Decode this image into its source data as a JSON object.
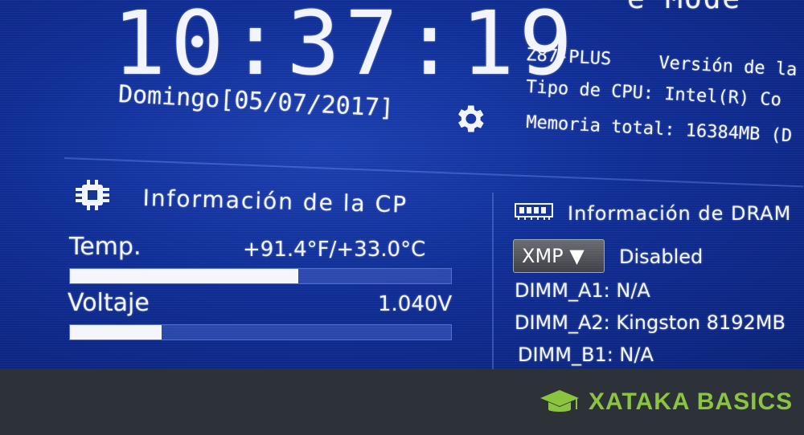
{
  "header": {
    "mode_title": "e Mode",
    "clock": "10:37:19",
    "date": "Domingo[05/07/2017]"
  },
  "system": {
    "model": "Z87-PLUS",
    "bios_version": "Versión de la",
    "cpu_type": "Tipo de CPU: Intel(R) Co",
    "memory_total": "Memoria total: 16384MB (D"
  },
  "cpu_info": {
    "title": "Información de la CP",
    "temp_label": "Temp.",
    "temp_value": "+91.4°F/+33.0°C",
    "temp_level": 0.6,
    "voltage_label": "Voltaje",
    "voltage_value": "1.040V",
    "voltage_level": 0.24
  },
  "dram_info": {
    "title": "Información de DRAM",
    "xmp_label": "XMP ▼",
    "xmp_status": "Disabled",
    "slots": [
      "DIMM_A1: N/A",
      "DIMM_A2: Kingston 8192MB",
      "DIMM_B1: N/A"
    ]
  },
  "footer": {
    "brand": "XATAKA BASICS"
  },
  "colors": {
    "bios_blue": "#0f2d95",
    "text": "#f2f5ff",
    "brand_green": "#8bc53f",
    "footer_bg": "#2d3138"
  },
  "icons": [
    "gear-icon",
    "cpu-chip-icon",
    "ram-module-icon",
    "graduation-cap-icon"
  ]
}
